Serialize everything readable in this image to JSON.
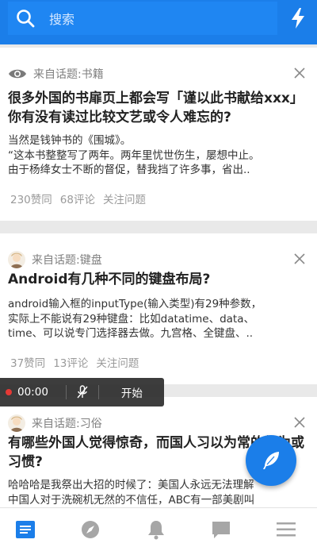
{
  "search": {
    "placeholder": "搜索"
  },
  "cards": [
    {
      "topic": "来自话题:书籍",
      "title": "很多外国的书扉页上都会写「谨以此书献给xxx」你有没有读过比较文艺或令人难忘的?",
      "excerpt_lines": [
        "当然是钱钟书的《围城》。",
        "“这本书整整写了两年。两年里忧世伤生，屡想中止。",
        "由于杨绛女士不断的督促，替我挡了许多事，省出.."
      ],
      "likes": "230赞同",
      "comments": "68评论",
      "follow": "关注问题"
    },
    {
      "topic": "来自话题:键盘",
      "title": "Android有几种不同的键盘布局?",
      "excerpt_lines": [
        "android输入框的inputType(输入类型)有29种参数，",
        "实际上不能说有29种键盘：比如datatime、data、",
        "time、可以说专门选择器去做。九宫格、全键盘、.."
      ],
      "likes": "37赞同",
      "comments": "13评论",
      "follow": "关注问题"
    },
    {
      "topic": "来自话题:习俗",
      "title": "有哪些外国人觉得惊奇，而国人习以为常的行为或习惯?",
      "excerpt_lines": [
        "哈哈哈是我祭出大招的时候了：美国人永远无法理解",
        "中国人对于洗碗机无然的不信任，ABC有一部美剧叫"
      ]
    }
  ],
  "recorder": {
    "time": "00:00",
    "start": "开始"
  },
  "colors": {
    "accent": "#1b7ee9",
    "record": "#e53935"
  },
  "tabs": [
    "feed-icon",
    "compass-icon",
    "bell-icon",
    "message-icon",
    "menu-icon"
  ]
}
